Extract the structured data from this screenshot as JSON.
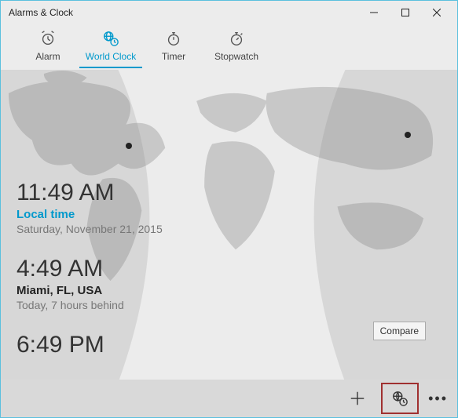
{
  "window": {
    "title": "Alarms & Clock"
  },
  "tabs": {
    "alarm": "Alarm",
    "world_clock": "World Clock",
    "timer": "Timer",
    "stopwatch": "Stopwatch"
  },
  "clocks": [
    {
      "time": "11:49 AM",
      "label": "Local time",
      "sub": "Saturday, November 21, 2015",
      "kind": "local"
    },
    {
      "time": "4:49 AM",
      "label": "Miami, FL, USA",
      "sub": "Today, 7 hours behind",
      "kind": "city"
    },
    {
      "time": "6:49 PM",
      "label": "",
      "sub": "",
      "kind": "city"
    }
  ],
  "tooltip": "Compare",
  "colors": {
    "accent": "#0099cc",
    "highlight_border": "#a03030"
  }
}
